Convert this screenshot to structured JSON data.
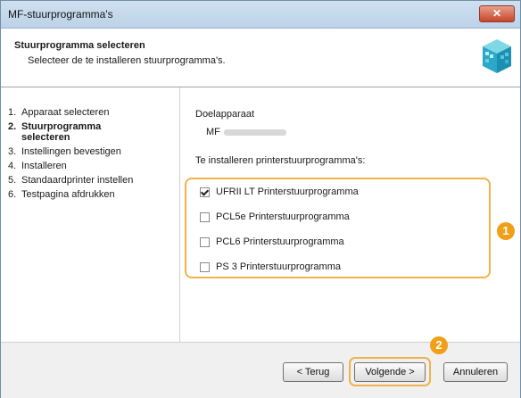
{
  "window": {
    "title": "MF-stuurprogramma's",
    "close_glyph": "✕"
  },
  "header": {
    "title": "Stuurprogramma selecteren",
    "subtitle": "Selecteer de te installeren stuurprogramma's.",
    "icon": "setup-box-icon"
  },
  "steps": [
    {
      "num": "1.",
      "label": "Apparaat selecteren"
    },
    {
      "num": "2.",
      "label": "Stuurprogramma selecteren"
    },
    {
      "num": "3.",
      "label": "Instellingen bevestigen"
    },
    {
      "num": "4.",
      "label": "Installeren"
    },
    {
      "num": "5.",
      "label": "Standaardprinter instellen"
    },
    {
      "num": "6.",
      "label": "Testpagina afdrukken"
    }
  ],
  "main": {
    "target_label": "Doelapparaat",
    "target_value": "MF",
    "drivers_label": "Te installeren printerstuurprogramma's:",
    "drivers": [
      {
        "label": "UFRII LT Printerstuurprogramma",
        "checked": true
      },
      {
        "label": "PCL5e Printerstuurprogramma",
        "checked": false
      },
      {
        "label": "PCL6 Printerstuurprogramma",
        "checked": false
      },
      {
        "label": "PS 3 Printerstuurprogramma",
        "checked": false
      }
    ]
  },
  "callouts": {
    "one": "1",
    "two": "2"
  },
  "footer": {
    "back_label": "< Terug",
    "next_label": "Volgende >",
    "cancel_label": "Annuleren"
  },
  "colors": {
    "callout": "#f0a018",
    "titlebar": "#bcd2e8"
  }
}
